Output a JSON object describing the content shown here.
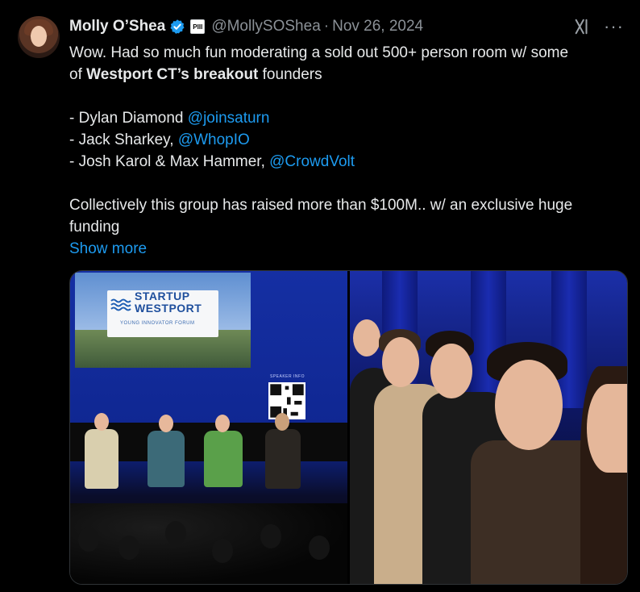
{
  "tweet": {
    "author_name": "Molly O’Shea",
    "affiliation_badge": "PIII",
    "handle": "@MollySOShea",
    "separator": "·",
    "date": "Nov 26, 2024",
    "more_icon": "···",
    "text": {
      "line1_a": "Wow. Had so much fun moderating a sold out 500+ person room w/ some",
      "line2_a": "of ",
      "line2_bold": "Westport CT’s breakout",
      "line2_b": " founders",
      "founders": [
        {
          "prefix": "- Dylan Diamond ",
          "mention": "@joinsaturn"
        },
        {
          "prefix": "- Jack Sharkey, ",
          "mention": "@WhopIO"
        },
        {
          "prefix": "- Josh Karol & Max Hammer, ",
          "mention": "@CrowdVolt"
        }
      ],
      "closing": "Collectively this group has raised more than $100M.. w/ an exclusive huge funding"
    },
    "show_more": "Show more",
    "media": {
      "slide_logo_line1": "STARTUP",
      "slide_logo_line2": "WESTPORT",
      "slide_subtitle": "YOUNG INNOVATOR FORUM",
      "qr_label": "SPEAKER INFO"
    }
  },
  "colors": {
    "background": "#000000",
    "text": "#e7e9ea",
    "muted": "#8b9197",
    "link": "#1d9bf0",
    "verified": "#1d9bf0"
  }
}
